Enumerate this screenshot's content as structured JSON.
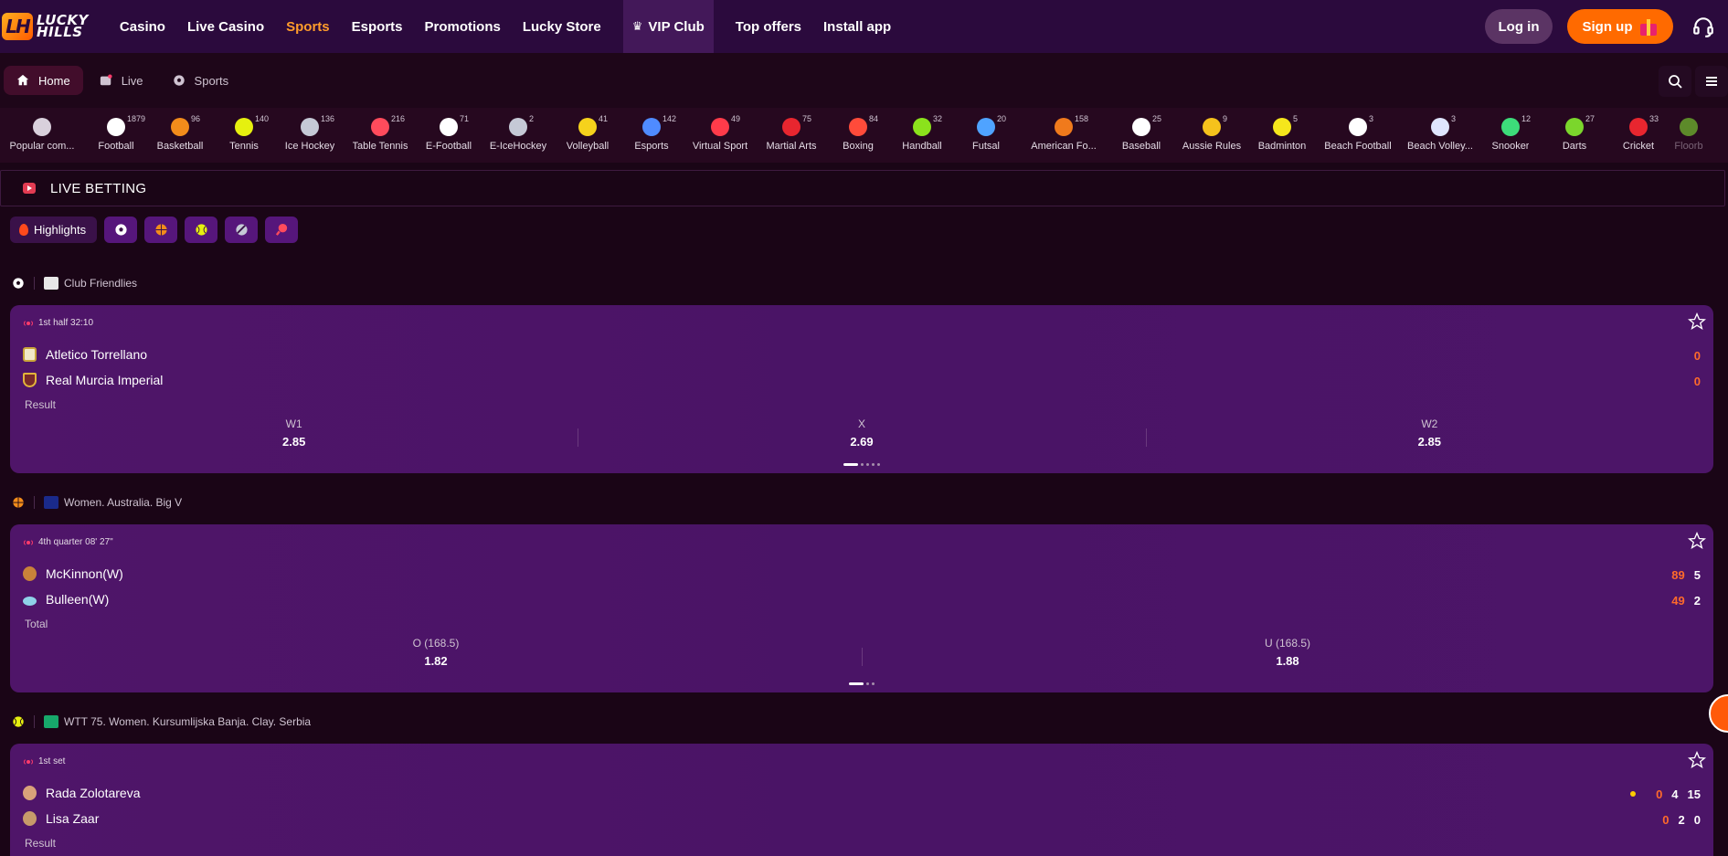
{
  "header": {
    "logo_top": "LUCKY",
    "logo_bottom": "HILLS",
    "logo_mark": "LH",
    "nav": [
      {
        "label": "Casino"
      },
      {
        "label": "Live Casino"
      },
      {
        "label": "Sports",
        "active": true
      },
      {
        "label": "Esports"
      },
      {
        "label": "Promotions"
      },
      {
        "label": "Lucky Store"
      },
      {
        "label": "VIP Club",
        "icon": "crown-icon"
      },
      {
        "label": "Top offers"
      },
      {
        "label": "Install app"
      }
    ],
    "login_label": "Log in",
    "signup_label": "Sign up"
  },
  "subnav": {
    "items": [
      {
        "label": "Home",
        "icon": "home-icon",
        "active": true
      },
      {
        "label": "Live",
        "icon": "live-icon"
      },
      {
        "label": "Sports",
        "icon": "soccer-ball-icon"
      }
    ]
  },
  "sports": [
    {
      "name": "Popular com...",
      "count": "",
      "color": "#d9d0dc"
    },
    {
      "name": "Football",
      "count": "1879",
      "color": "#ffffff"
    },
    {
      "name": "Basketball",
      "count": "96",
      "color": "#f28c1b"
    },
    {
      "name": "Tennis",
      "count": "140",
      "color": "#e6f00f"
    },
    {
      "name": "Ice Hockey",
      "count": "136",
      "color": "#c5c9d6"
    },
    {
      "name": "Table Tennis",
      "count": "216",
      "color": "#ff4b5c"
    },
    {
      "name": "E-Football",
      "count": "71",
      "color": "#ffffff"
    },
    {
      "name": "E-IceHockey",
      "count": "2",
      "color": "#c5c9d6"
    },
    {
      "name": "Volleyball",
      "count": "41",
      "color": "#f5d21c"
    },
    {
      "name": "Esports",
      "count": "142",
      "color": "#4f8bff"
    },
    {
      "name": "Virtual Sport",
      "count": "49",
      "color": "#ff3b4a"
    },
    {
      "name": "Martial Arts",
      "count": "75",
      "color": "#e8262f"
    },
    {
      "name": "Boxing",
      "count": "84",
      "color": "#ff4b3a"
    },
    {
      "name": "Handball",
      "count": "32",
      "color": "#8be21c"
    },
    {
      "name": "Futsal",
      "count": "20",
      "color": "#4fa3ff"
    },
    {
      "name": "American Fo...",
      "count": "158",
      "color": "#f07a1c"
    },
    {
      "name": "Baseball",
      "count": "25",
      "color": "#ffffff"
    },
    {
      "name": "Aussie Rules",
      "count": "9",
      "color": "#f5c21c"
    },
    {
      "name": "Badminton",
      "count": "5",
      "color": "#f5e61c"
    },
    {
      "name": "Beach Football",
      "count": "3",
      "color": "#ffffff"
    },
    {
      "name": "Beach Volley...",
      "count": "3",
      "color": "#dfe6ff"
    },
    {
      "name": "Snooker",
      "count": "12",
      "color": "#3ddc7a"
    },
    {
      "name": "Darts",
      "count": "27",
      "color": "#7bd62c"
    },
    {
      "name": "Cricket",
      "count": "33",
      "color": "#e8262f"
    },
    {
      "name": "Floorb",
      "count": "",
      "color": "#5d8a2a"
    }
  ],
  "live": {
    "title": "LIVE BETTING",
    "highlights_label": "Highlights",
    "filter_icons": [
      "soccer-ball-icon",
      "basketball-icon",
      "tennis-ball-icon",
      "hockey-puck-icon",
      "table-tennis-icon"
    ]
  },
  "matches": [
    {
      "league": "Club Friendlies",
      "status": "1st half 32:10",
      "teams": [
        {
          "name": "Atletico Torrellano",
          "scores": [
            "0"
          ]
        },
        {
          "name": "Real Murcia Imperial",
          "scores": [
            "0"
          ]
        }
      ],
      "market": "Result",
      "odds": [
        {
          "label": "W1",
          "value": "2.85"
        },
        {
          "label": "X",
          "value": "2.69"
        },
        {
          "label": "W2",
          "value": "2.85"
        }
      ]
    },
    {
      "league": "Women. Australia. Big V",
      "status": "4th quarter 08' 27\"",
      "teams": [
        {
          "name": "McKinnon(W)",
          "scores": [
            "89",
            "5"
          ]
        },
        {
          "name": "Bulleen(W)",
          "scores": [
            "49",
            "2"
          ]
        }
      ],
      "market": "Total",
      "odds": [
        {
          "label": "O (168.5)",
          "value": "1.82"
        },
        {
          "label": "U (168.5)",
          "value": "1.88"
        }
      ]
    },
    {
      "league": "WTT 75. Women. Kursumlijska Banja. Clay. Serbia",
      "status": "1st set",
      "teams": [
        {
          "name": "Rada Zolotareva",
          "scores": [
            "0",
            "4",
            "15"
          ],
          "serving": true
        },
        {
          "name": "Lisa Zaar",
          "scores": [
            "0",
            "2",
            "0"
          ]
        }
      ],
      "market": "Result"
    }
  ]
}
